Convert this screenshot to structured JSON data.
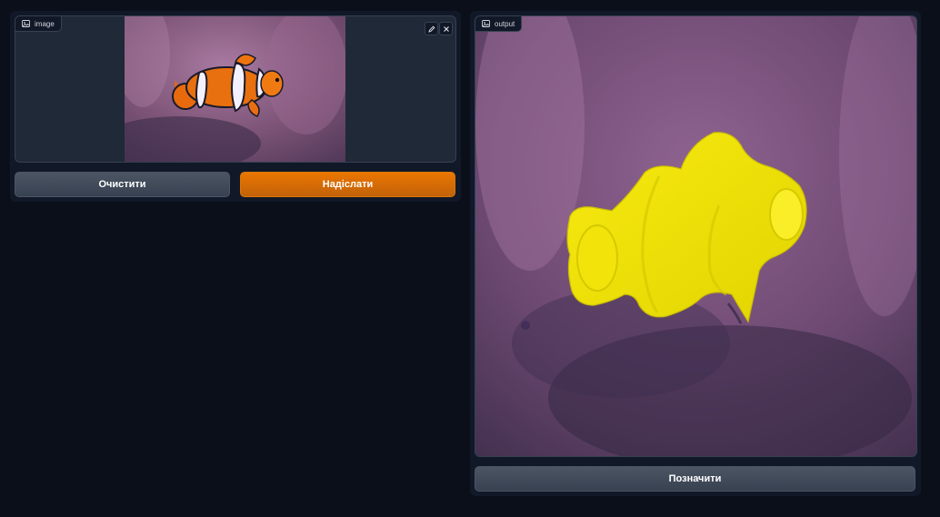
{
  "input_panel": {
    "label": "image",
    "label_icon": "image-icon",
    "edit_icon": "pencil-icon",
    "close_icon": "close-icon",
    "image_description_icon": "clownfish-photo"
  },
  "buttons": {
    "clear_label": "Очистити",
    "submit_label": "Надіслати",
    "flag_label": "Позначити"
  },
  "output_panel": {
    "label": "output",
    "label_icon": "image-icon"
  },
  "colors": {
    "background": "#0b0f19",
    "panel": "#111827",
    "primary": "#d97706",
    "mask": "#f2e600"
  }
}
